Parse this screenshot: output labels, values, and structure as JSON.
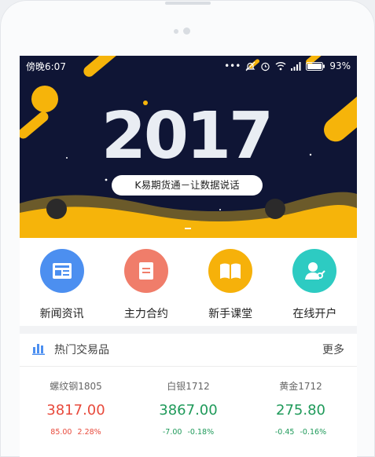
{
  "status_bar": {
    "time": "傍晚6:07",
    "battery": "93%",
    "icons": [
      "more-dots-icon",
      "mute-alarm-icon",
      "alarm-icon",
      "wifi-icon",
      "signal-icon",
      "battery-icon"
    ]
  },
  "banner": {
    "year": "2017",
    "slogan": "K易期货通－让数据说话",
    "colors": {
      "background": "#0f1535",
      "accent": "#f6b40a"
    }
  },
  "quick_menu": [
    {
      "label": "新闻资讯",
      "icon": "news-icon",
      "color": "#4c8ff0"
    },
    {
      "label": "主力合约",
      "icon": "contract-icon",
      "color": "#f07d6a"
    },
    {
      "label": "新手课堂",
      "icon": "book-icon",
      "color": "#f6b10a"
    },
    {
      "label": "在线开户",
      "icon": "account-key-icon",
      "color": "#2dcbc2"
    }
  ],
  "hot_section": {
    "title": "热门交易品",
    "more": "更多",
    "icon": "bar-chart-icon",
    "products": [
      {
        "name": "螺纹钢1805",
        "price": "3817.00",
        "change": "85.00",
        "percent": "2.28%",
        "trend": "up"
      },
      {
        "name": "白银1712",
        "price": "3867.00",
        "change": "-7.00",
        "percent": "-0.18%",
        "trend": "down"
      },
      {
        "name": "黄金1712",
        "price": "275.80",
        "change": "-0.45",
        "percent": "-0.16%",
        "trend": "down"
      }
    ]
  }
}
